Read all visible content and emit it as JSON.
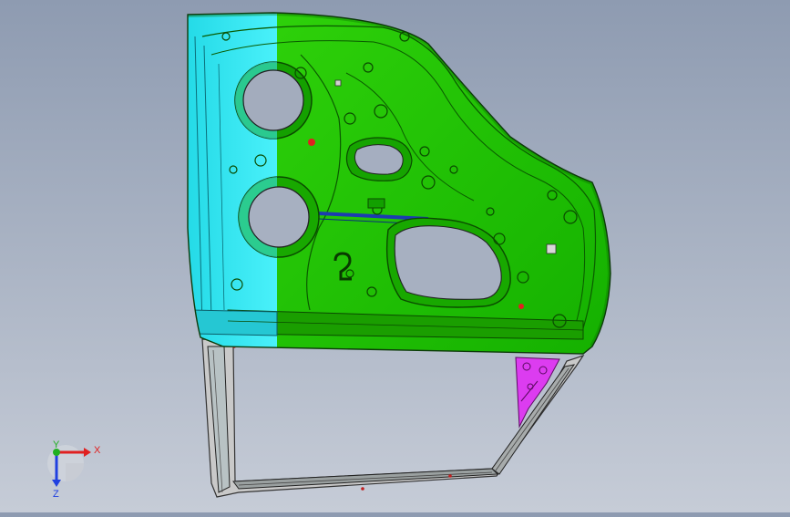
{
  "viewport": {
    "background_top": "#8e9bb1",
    "background_bottom": "#c6ccd7"
  },
  "model": {
    "parts": [
      {
        "name": "inner-panel-front",
        "color": "#3ee8f0"
      },
      {
        "name": "inner-panel-rear",
        "color": "#1ec400"
      },
      {
        "name": "window-frame",
        "color": "#d8d8d8"
      },
      {
        "name": "corner-bracket",
        "color": "#e43ff0"
      }
    ]
  },
  "triad": {
    "x_label": "X",
    "y_label": "Y",
    "z_label": "Z",
    "x_color": "#e02020",
    "y_color": "#20b020",
    "z_color": "#2040e0"
  }
}
